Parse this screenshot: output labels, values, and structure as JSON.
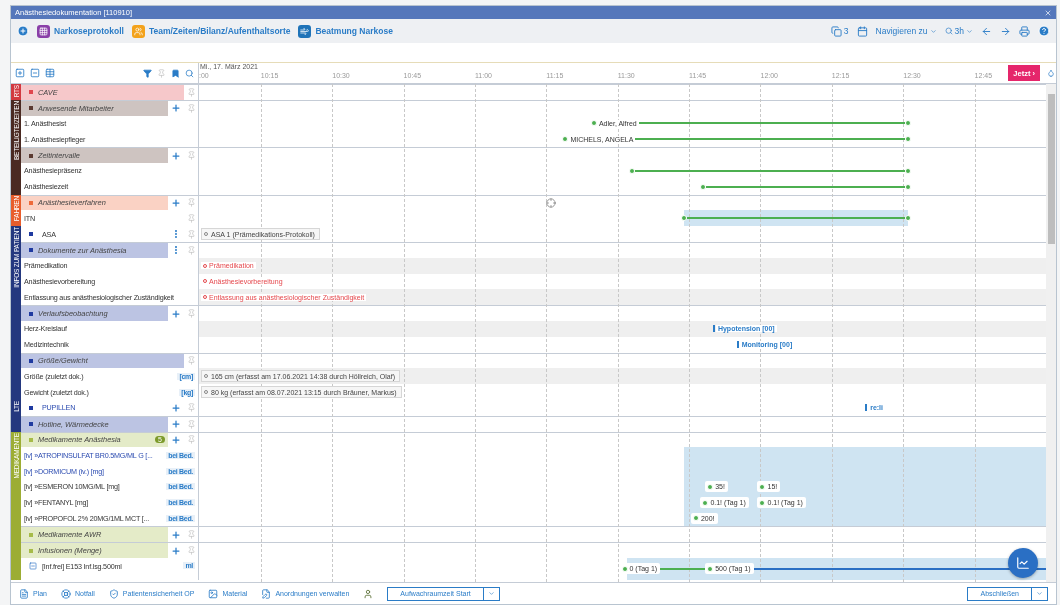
{
  "window": {
    "title": "Anästhesiedokumentation [110910]"
  },
  "toolbar": {
    "tabs": [
      {
        "label": "Narkoseprotokoll",
        "color": "#8a3fa8"
      },
      {
        "label": "Team/Zeiten/Bilanz/Aufenthaltsorte",
        "color": "#f3a21b"
      },
      {
        "label": "Beatmung Narkose",
        "color": "#1f73b8"
      }
    ],
    "badge": "3",
    "navigate": "Navigieren zu",
    "zoom": "3h"
  },
  "timeline": {
    "date": "Mi., 17. März 2021",
    "now_button": "Jetzt ›",
    "ticks": [
      ":00",
      "10:15",
      "10:30",
      "10:45",
      "11:00",
      "11:15",
      "11:30",
      "11:45",
      "12:00",
      "12:15",
      "12:30",
      "12:45"
    ]
  },
  "groups": [
    {
      "strip": "RTS",
      "color": "#d23a41",
      "rows": [
        {
          "kind": "header",
          "label": "CAVE",
          "color": "#e0474f",
          "add": false,
          "menu": false,
          "pin": true
        }
      ]
    },
    {
      "strip": "BETEILIGTE/ZEITEN",
      "color": "#4a2a22",
      "rows": [
        {
          "kind": "header",
          "label": "Anwesende Mitarbeiter",
          "color": "#5b3a31",
          "add": true,
          "menu": false,
          "pin": true
        },
        {
          "kind": "item",
          "label": "1. Anästhesist",
          "events": [
            {
              "kind": "span",
              "label": "Adler, Alfred"
            }
          ]
        },
        {
          "kind": "item",
          "label": "1. Anästhesiepfleger",
          "events": [
            {
              "kind": "span",
              "label": "MICHELS, ANGELA"
            }
          ]
        },
        {
          "kind": "header",
          "label": "Zeitintervalle",
          "color": "#5b3a31",
          "add": true,
          "menu": false,
          "pin": true
        },
        {
          "kind": "item",
          "label": "Anästhesiepräsenz",
          "events": [
            {
              "kind": "span"
            }
          ]
        },
        {
          "kind": "item",
          "label": "Anästhesiezeit",
          "events": [
            {
              "kind": "span"
            }
          ]
        }
      ]
    },
    {
      "strip": "FAHREN",
      "color": "#e85d2c",
      "rows": [
        {
          "kind": "header",
          "label": "Anästhesieverfahren",
          "color": "#ee6a3a",
          "add": true,
          "menu": false,
          "pin": true,
          "events": [
            {
              "kind": "target"
            }
          ]
        },
        {
          "kind": "item",
          "label": "ITN",
          "pin": true,
          "highlighted": true,
          "events": [
            {
              "kind": "span"
            }
          ]
        }
      ]
    },
    {
      "strip": "INFOS ZUM PATIENT",
      "color": "#24387f",
      "rows": [
        {
          "kind": "item",
          "label": "ASA",
          "color": "#1f3aa0",
          "menu": true,
          "pin": true,
          "events": [
            {
              "kind": "note",
              "label": "ASA 1 (Prämedikations-Protokoll)"
            }
          ]
        },
        {
          "kind": "header",
          "label": "Dokumente zur Anästhesia",
          "color": "#1f3aa0",
          "add": false,
          "menu": true,
          "pin": true
        },
        {
          "kind": "item",
          "label": "Prämedikation",
          "shaded": true,
          "events": [
            {
              "kind": "alert",
              "label": "Prämedikation"
            }
          ]
        },
        {
          "kind": "item",
          "label": "Anästhesievorbereitung",
          "shaded": false,
          "events": [
            {
              "kind": "alert",
              "label": "Anästhesievorbereitung"
            }
          ]
        },
        {
          "kind": "item",
          "label": "Entlassung aus anästhesiologischer Zuständigkeit",
          "shaded": true,
          "events": [
            {
              "kind": "alert",
              "label": "Entlassung aus anästhesiologischer Zuständigkeit"
            }
          ]
        },
        {
          "kind": "header",
          "label": "Verlaufsbeobachtung",
          "color": "#1f3aa0",
          "add": true,
          "menu": false,
          "pin": true
        },
        {
          "kind": "item",
          "label": "Herz-Kreislauf",
          "shaded": true,
          "events": [
            {
              "kind": "marker",
              "label": "Hypotension [00]"
            }
          ]
        },
        {
          "kind": "item",
          "label": "Medizintechnik",
          "events": [
            {
              "kind": "marker",
              "label": "Monitoring [00]"
            }
          ]
        },
        {
          "kind": "header",
          "label": "Größe/Gewicht",
          "color": "#1f3aa0",
          "add": false,
          "menu": false,
          "pin": true
        },
        {
          "kind": "item",
          "label": "Größe (zuletzt dok.)",
          "unit": "[cm]",
          "shaded": true,
          "events": [
            {
              "kind": "note",
              "label": "165 cm (erfasst am 17.06.2021 14:38 durch Höllreich, Olaf)"
            }
          ]
        },
        {
          "kind": "item",
          "label": "Gewicht (zuletzt dok.)",
          "unit": "[kg]",
          "events": [
            {
              "kind": "note",
              "label": "80 kg (erfasst am 08.07.2021 13:15 durch Bräuner, Markus)"
            }
          ]
        }
      ]
    },
    {
      "strip": "LTE",
      "color": "#24387f",
      "rows": [
        {
          "kind": "item",
          "label": "PUPILLEN",
          "color": "#1f3aa0",
          "active": true,
          "add": true,
          "pin": true,
          "events": [
            {
              "kind": "marker",
              "label": "re:li"
            }
          ]
        },
        {
          "kind": "header",
          "label": "Hotline, Wärmedecke",
          "color": "#1f3aa0",
          "add": true,
          "menu": false,
          "pin": true
        }
      ]
    },
    {
      "strip": "MEDIKAMENTE",
      "color": "#9cad34",
      "rows": [
        {
          "kind": "header",
          "label": "Medikamente Anästhesia",
          "color": "#a6bb48",
          "badge": "5",
          "add": true,
          "menu": false,
          "pin": true
        },
        {
          "kind": "item",
          "label": "[iv] »ATROPINSULFAT BR0.5MG/ML G [...",
          "active": true,
          "unit": "bei Bed.",
          "highlighted": true
        },
        {
          "kind": "item",
          "label": "[iv] »DORMICUM (iv.) [mg]",
          "active": true,
          "unit": "bei Bed.",
          "highlighted": true
        },
        {
          "kind": "item",
          "label": "[iv] »ESMERON 10MG/ML [mg]",
          "active": false,
          "unit": "bei Bed.",
          "highlighted": true,
          "events": [
            {
              "kind": "dose",
              "label": "35!"
            },
            {
              "kind": "dose",
              "label": "15!"
            }
          ]
        },
        {
          "kind": "item",
          "label": "[iv] »FENTANYL [mg]",
          "active": false,
          "unit": "bei Bed.",
          "highlighted": true,
          "events": [
            {
              "kind": "dose",
              "label": "0.1! (Tag 1)"
            },
            {
              "kind": "dose",
              "label": "0.1! (Tag 1)"
            }
          ]
        },
        {
          "kind": "item",
          "label": "[iv] »PROPOFOL 2% 20MG/1ML MCT [...",
          "active": false,
          "unit": "bei Bed.",
          "highlighted": true,
          "events": [
            {
              "kind": "dose",
              "label": "200!"
            }
          ]
        },
        {
          "kind": "header",
          "label": "Medikamente AWR",
          "color": "#a6bb48",
          "add": true,
          "menu": false,
          "pin": true
        },
        {
          "kind": "header",
          "label": "Infusionen (Menge)",
          "color": "#a6bb48",
          "add": true,
          "menu": false,
          "pin": true
        },
        {
          "kind": "item",
          "label": "[Inf.frei] E153 Inf.lsg.500ml",
          "expanded": true,
          "tall": true,
          "unit": "ml",
          "highlighted": true,
          "lines": [
            {
              "kind": "given"
            },
            {
              "kind": "running"
            }
          ],
          "events": [
            {
              "kind": "dose",
              "label": "0 (Tag 1)"
            },
            {
              "kind": "dose",
              "label": "500 (Tag 1)"
            }
          ]
        }
      ]
    }
  ],
  "bottom_bar": {
    "items": [
      "Plan",
      "Notfall",
      "Patientensicherheit OP",
      "Material",
      "Anordnungen verwalten"
    ],
    "start_button": "Aufwachraumzeit Start",
    "finish_button": "Abschließen"
  }
}
